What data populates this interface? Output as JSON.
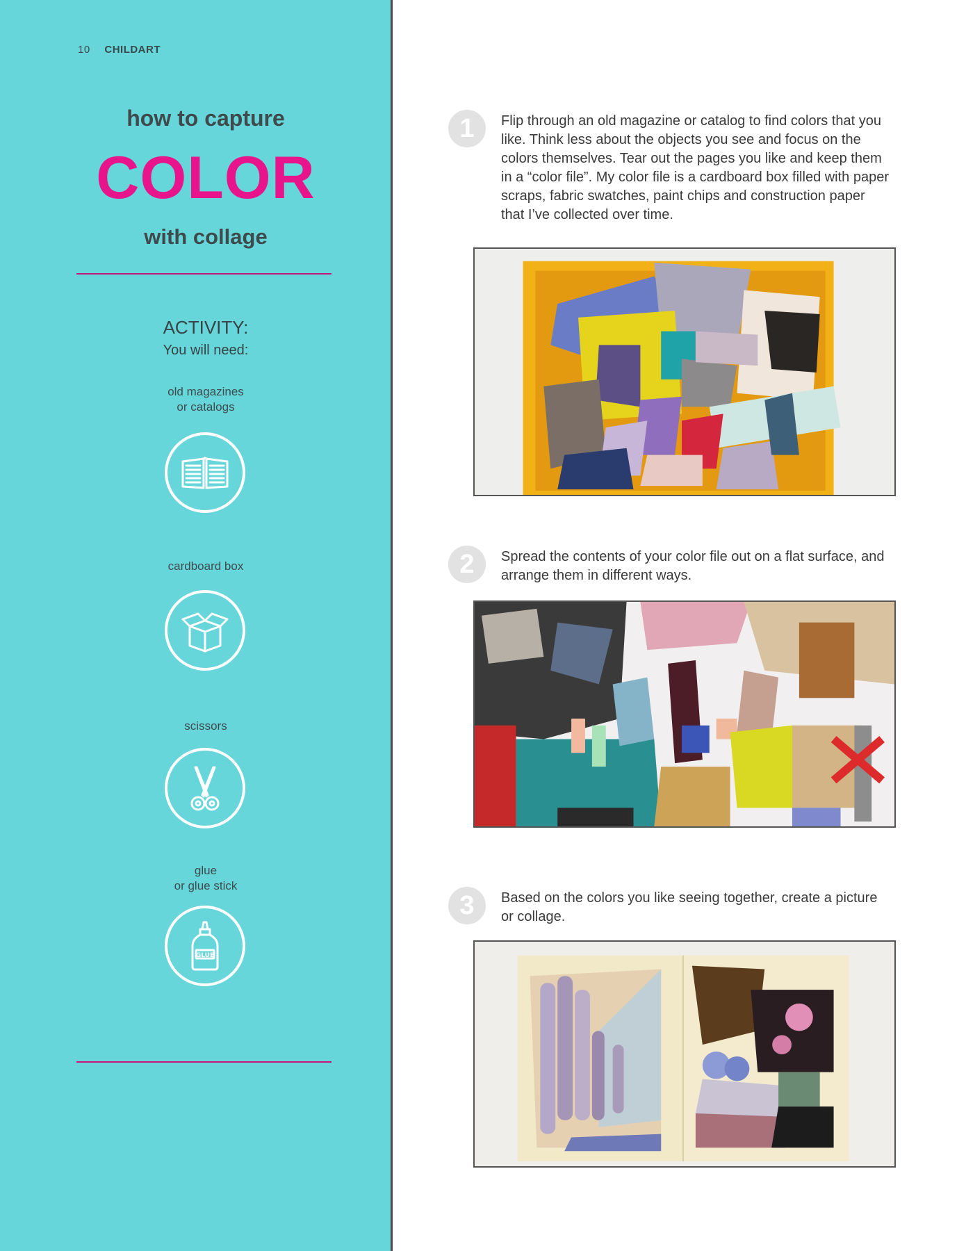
{
  "header": {
    "page_number": "10",
    "magazine": "CHILDART"
  },
  "title": {
    "line1": "how to capture",
    "line2": "COLOR",
    "line3": "with collage"
  },
  "activity": {
    "heading": "ACTIVITY:",
    "subheading": "You will need:",
    "supplies": [
      {
        "label": "old magazines or catalogs",
        "line1": "old magazines",
        "line2": "or catalogs",
        "icon": "open-book-icon"
      },
      {
        "label": "cardboard box",
        "line1": "cardboard box",
        "line2": "",
        "icon": "open-box-icon"
      },
      {
        "label": "scissors",
        "line1": "scissors",
        "line2": "",
        "icon": "scissors-icon"
      },
      {
        "label": "glue or glue stick",
        "line1": "glue",
        "line2": "or glue stick",
        "icon": "glue-bottle-icon",
        "icon_text": "GLUE"
      }
    ]
  },
  "steps": [
    {
      "number": "1",
      "text": "Flip through an old magazine or catalog to find colors that you like. Think less about the objects you see and focus on the colors themselves. Tear out the pages you like and keep them in a “color file”. My color file is a cardboard box filled with paper scraps, fabric swatches, paint chips and construction paper that I’ve collected over time.",
      "photo": "color-file-box-photo"
    },
    {
      "number": "2",
      "text": "Spread the contents of your color file out on a flat surface, and arrange them in different ways.",
      "photo": "spread-paper-scraps-photo"
    },
    {
      "number": "3",
      "text": "Based on the colors you like seeing together, create a picture or collage.",
      "photo": "finished-collage-sketchbook-photo"
    }
  ],
  "colors": {
    "panel": "#66d6da",
    "accent": "#e8148c",
    "rule": "#c2187d",
    "step_circle": "#e2e2e2"
  }
}
